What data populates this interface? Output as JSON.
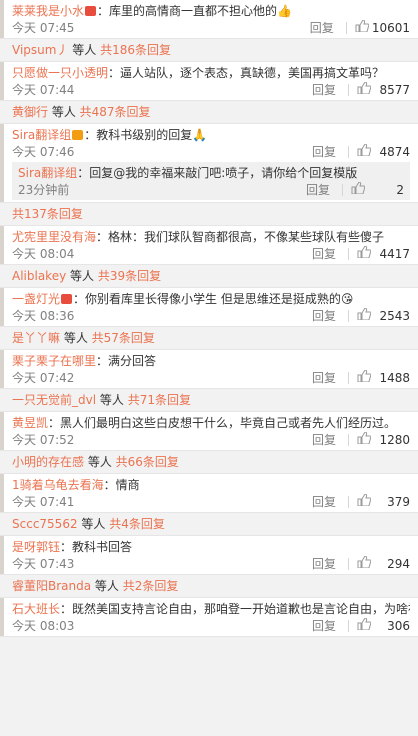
{
  "comments": [
    {
      "user": "莱莱我是小水",
      "badge": "",
      "flag": "#e74c3c",
      "text": "：库里的高情商一直都不担心他的👍",
      "time": "今天 07:45",
      "likes": "10601",
      "sub": {
        "user": "Vipsum丿",
        "count": "共186条回复"
      }
    },
    {
      "user": "只愿做一只小透明",
      "badge": "",
      "text": "：逼人站队，逐个表态，真缺德，美国再搞文革吗？",
      "time": "今天 07:44",
      "likes": "8577",
      "sub": {
        "user": "黄御行",
        "count": "共487条回复"
      }
    },
    {
      "user": "Sira翻译组",
      "badge": "",
      "flag": "#f39c12",
      "text": "：教科书级别的回复🙏",
      "time": "今天 07:46",
      "likes": "4874",
      "nested": {
        "user": "Sira翻译组",
        "text": "：回复@我的幸福来敲门吧:喷子，请你给个回复模版",
        "time": "23分钟前",
        "likes": "2"
      },
      "sub": {
        "user": "",
        "count": "共137条回复"
      }
    },
    {
      "user": "尤宪里里没有海",
      "badge": "",
      "text": "：格林：我们球队智商都很高，不像某些球队有些傻子",
      "time": "今天 08:04",
      "likes": "4417",
      "sub": {
        "user": "Aliblakey",
        "count": "共39条回复"
      }
    },
    {
      "user": "一盏灯光",
      "badge": "",
      "flag": "#e74c3c",
      "text": "：你别看库里长得像小学生 但是思维还是挺成熟的😘",
      "time": "今天 08:36",
      "likes": "2543",
      "sub": {
        "user": "是丫丫嘛",
        "count": "共57条回复"
      }
    },
    {
      "user": "栗子栗子在哪里",
      "badge": "",
      "text": "：满分回答",
      "time": "今天 07:42",
      "likes": "1488",
      "sub": {
        "user": "一只无觉前_dvl",
        "count": "共71条回复"
      }
    },
    {
      "user": "黄昱凯",
      "badge": "",
      "text": "：黑人们最明白这些白皮想干什么，毕竟自己或者先人们经历过。",
      "time": "今天 07:52",
      "likes": "1280",
      "sub": {
        "user": "小明的存在感",
        "count": "共66条回复"
      }
    },
    {
      "user": "1骑着乌龟去看海",
      "badge": "",
      "text": "：情商",
      "time": "今天 07:41",
      "likes": "379",
      "sub": {
        "user": "Sccc75562",
        "count": "共4条回复"
      }
    },
    {
      "user": "是呀郭钰",
      "badge": "",
      "text": "：教科书回答",
      "time": "今天 07:43",
      "likes": "294",
      "sub": {
        "user": "睿董阳Branda",
        "count": "共2条回复"
      }
    },
    {
      "user": "石大班长",
      "badge": "",
      "text": "：既然美国支持言论自由，那咱登一开始道歉也是言论自由，为啥被喷？自相矛盾，双标至极。",
      "time": "今天 08:03",
      "likes": "306"
    }
  ],
  "labels": {
    "reply": "回复",
    "and": "等人"
  }
}
